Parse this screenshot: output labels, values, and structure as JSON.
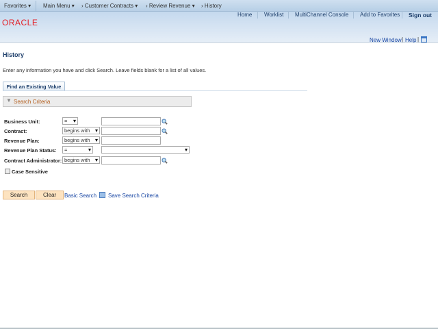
{
  "nav": {
    "favorites": "Favorites",
    "main_menu": "Main Menu",
    "crumbs": [
      "Customer Contracts",
      "Review Revenue",
      "History"
    ]
  },
  "header_links": {
    "home": "Home",
    "worklist": "Worklist",
    "multichannel": "MultiChannel Console",
    "add_favorites": "Add to Favorites",
    "sign_out": "Sign out"
  },
  "logo": "ORACLE",
  "toolbar": {
    "new_window": "New Window",
    "help": "Help"
  },
  "page": {
    "title": "History",
    "instructions": "Enter any information you have and click Search. Leave fields blank for a list of all values.",
    "tab": "Find an Existing Value",
    "section": "Search Criteria"
  },
  "fields": [
    {
      "label": "Business Unit:",
      "operator": "=",
      "value": ""
    },
    {
      "label": "Contract:",
      "operator": "begins with",
      "value": ""
    },
    {
      "label": "Revenue Plan:",
      "operator": "begins with",
      "value": ""
    },
    {
      "label": "Revenue Plan Status:",
      "operator": "=",
      "value": ""
    },
    {
      "label": "Contract Administrator:",
      "operator": "begins with",
      "value": ""
    }
  ],
  "case_sensitive": {
    "label": "Case Sensitive",
    "checked": false
  },
  "buttons": {
    "search": "Search",
    "clear": "Clear",
    "basic_search": "Basic Search",
    "save_criteria": "Save Search Criteria"
  }
}
